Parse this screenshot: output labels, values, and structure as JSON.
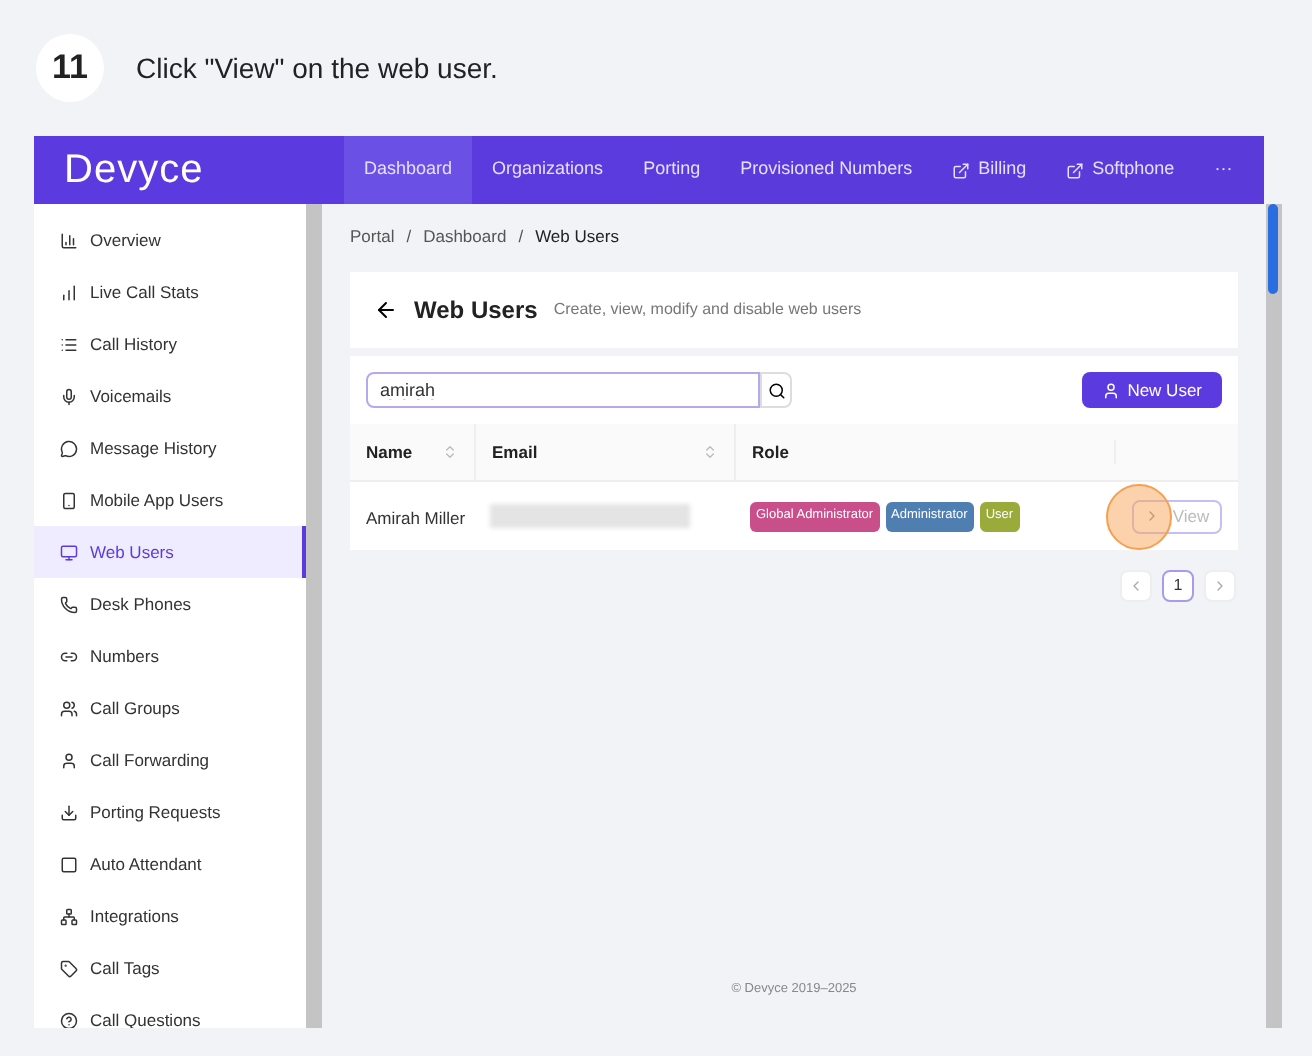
{
  "step": {
    "number": "11",
    "instruction": "Click \"View\" on the web user."
  },
  "app": {
    "logo": "Devyce",
    "nav": [
      {
        "label": "Dashboard",
        "selected": true,
        "kind": "link"
      },
      {
        "label": "Organizations",
        "selected": false,
        "kind": "link"
      },
      {
        "label": "Porting",
        "selected": false,
        "kind": "link"
      },
      {
        "label": "Provisioned Numbers",
        "selected": false,
        "kind": "link"
      },
      {
        "label": "Billing",
        "selected": false,
        "kind": "external"
      },
      {
        "label": "Softphone",
        "selected": false,
        "kind": "external"
      },
      {
        "label": "···",
        "selected": false,
        "kind": "link"
      }
    ],
    "sidebar": {
      "items": [
        {
          "label": "Overview",
          "selected": false
        },
        {
          "label": "Live Call Stats",
          "selected": false
        },
        {
          "label": "Call History",
          "selected": false
        },
        {
          "label": "Voicemails",
          "selected": false
        },
        {
          "label": "Message History",
          "selected": false
        },
        {
          "label": "Mobile App Users",
          "selected": false
        },
        {
          "label": "Web Users",
          "selected": true
        },
        {
          "label": "Desk Phones",
          "selected": false
        },
        {
          "label": "Numbers",
          "selected": false
        },
        {
          "label": "Call Groups",
          "selected": false
        },
        {
          "label": "Call Forwarding",
          "selected": false
        },
        {
          "label": "Porting Requests",
          "selected": false
        },
        {
          "label": "Auto Attendant",
          "selected": false
        },
        {
          "label": "Integrations",
          "selected": false
        },
        {
          "label": "Call Tags",
          "selected": false
        },
        {
          "label": "Call Questions",
          "selected": false
        }
      ]
    }
  },
  "breadcrumb": [
    {
      "label": "Portal",
      "kind": "link"
    },
    {
      "label": "/",
      "kind": "separator"
    },
    {
      "label": "Dashboard",
      "kind": "link"
    },
    {
      "label": "/",
      "kind": "separator"
    },
    {
      "label": "Web Users",
      "kind": "current"
    }
  ],
  "page": {
    "title": "Web Users",
    "subtitle": "Create, view, modify and disable web users"
  },
  "search": {
    "value": "amirah"
  },
  "new_user_button": "New User",
  "table": {
    "columns": [
      {
        "label": "Name",
        "sortable": true
      },
      {
        "label": "Email",
        "sortable": true
      },
      {
        "label": "Role",
        "sortable": false
      }
    ],
    "rows": [
      {
        "name": "Amirah Miller",
        "roles": [
          {
            "label": "Global Administrator",
            "color": "#c94f8a"
          },
          {
            "label": "Administrator",
            "color": "#4f7fb0"
          },
          {
            "label": "User",
            "color": "#9aab3c"
          }
        ],
        "action": "View"
      }
    ]
  },
  "pagination": {
    "pages": [
      {
        "label": "1",
        "selected": true
      }
    ]
  },
  "footer": "© Devyce 2019–2025"
}
